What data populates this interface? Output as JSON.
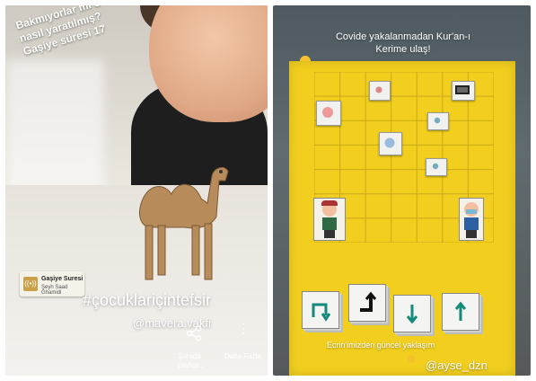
{
  "left_story": {
    "caption_lines": [
      "Bakmıyorlar mı o deve",
      "nasıl yaratılmış?",
      "Gaşiye süresi 17"
    ],
    "music": {
      "title": "Gaşiye Suresi",
      "artist": "Şeyh Saad Ghamidi",
      "cover_glyph": "((•))"
    },
    "hashtag": "#çocuklariçintefsir",
    "mention": "@mavera.vakfi",
    "share_label": "Şurada paylaş...",
    "more_label": "Daha Fazla"
  },
  "right_story": {
    "caption_lines": [
      "Covide yakalanmadan Kur'an-ı",
      "Kerime ulaş!"
    ],
    "bottom_caption": "Ecrin'imizden güncel yaklaşım",
    "mention": "@ayse_dzn",
    "board_color": "#f2cf1f"
  },
  "colors": {
    "board": "#f2cf1f",
    "text": "#ffffff"
  }
}
